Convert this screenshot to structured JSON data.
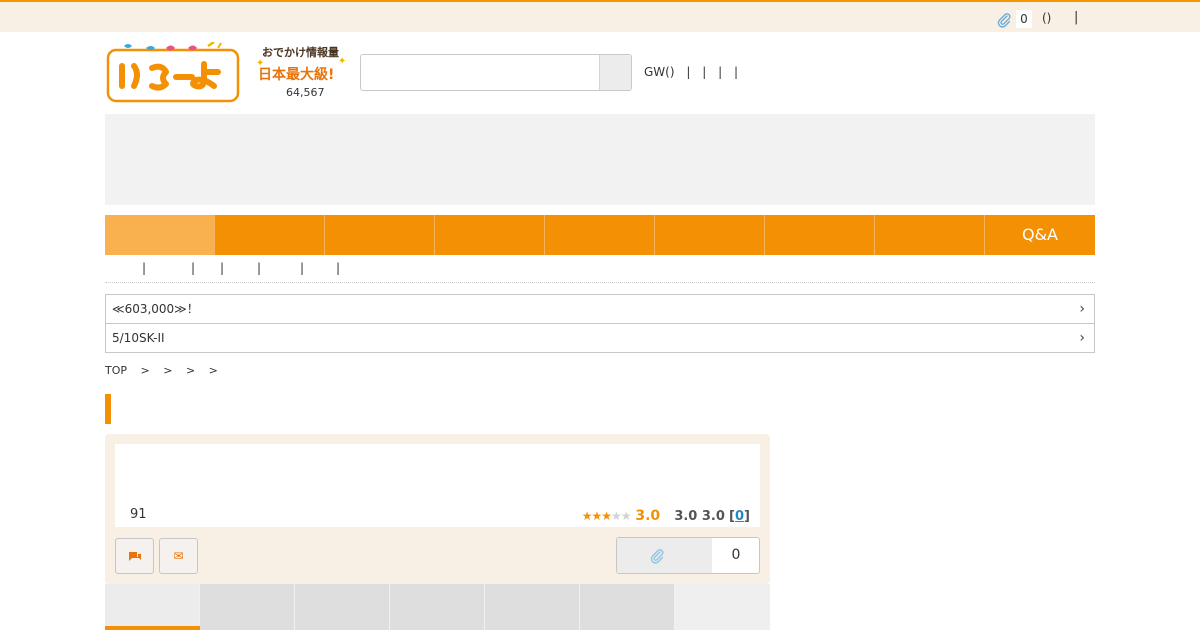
{
  "topbar": {
    "clip_icon": "paperclip-icon",
    "clip_count": "0",
    "paren": "()",
    "separator": "|"
  },
  "header": {
    "logo_text": "いこーよ",
    "tagline_line1": "おでかけ情報量",
    "tagline_line2": "日本最大級!",
    "spot_count": "64,567",
    "search": {
      "placeholder": "",
      "value": ""
    },
    "links": [
      "GW()",
      "|",
      "|",
      "|",
      "|"
    ]
  },
  "nav": {
    "tabs": [
      "",
      "",
      "",
      "",
      "",
      "",
      "",
      "",
      "Q&A"
    ]
  },
  "subnav": {
    "separators": [
      "|",
      "|",
      "|",
      "|",
      "|",
      "|"
    ]
  },
  "notices": [
    {
      "text": "≪603,000≫！",
      "icon": "chevron-right-icon"
    },
    {
      "text": "5/10SK-II",
      "icon": "chevron-right-icon"
    }
  ],
  "breadcrumb": [
    "TOP",
    ">",
    ">",
    ">",
    ">"
  ],
  "spot": {
    "number": "91",
    "rating_value": 3,
    "rating_score": "3.0",
    "sub_scores": "3.0 3.0",
    "review_link": "0",
    "clip_count": "0",
    "buttons": [
      "chat-icon",
      "mail-icon"
    ]
  },
  "colors": {
    "accent": "#f39004",
    "accent_light": "#f9b150",
    "cream": "#f8efe5"
  }
}
